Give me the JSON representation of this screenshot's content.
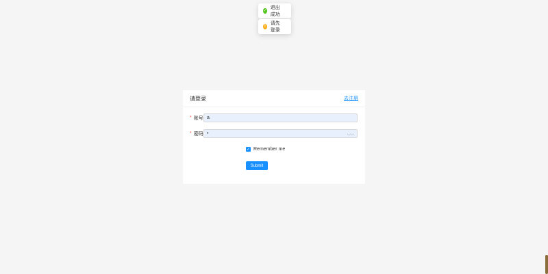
{
  "toasts": [
    {
      "text": "退出成功",
      "type": "success",
      "icon": "check-circle-icon",
      "color": "#52c41a"
    },
    {
      "text": "请先登录",
      "type": "warning",
      "icon": "exclamation-circle-icon",
      "color": "#faad14"
    }
  ],
  "card": {
    "title": "请登录",
    "register_link": "去注册"
  },
  "form": {
    "account_label": "账号:",
    "account_value": "a",
    "password_label": "密码:",
    "password_value": "•",
    "remember_label": "Remember me",
    "remember_checked": true,
    "submit_label": "Submit"
  },
  "colors": {
    "primary": "#1890ff",
    "required": "#ff4d4f",
    "autofill_bg": "#e8f0fe"
  }
}
